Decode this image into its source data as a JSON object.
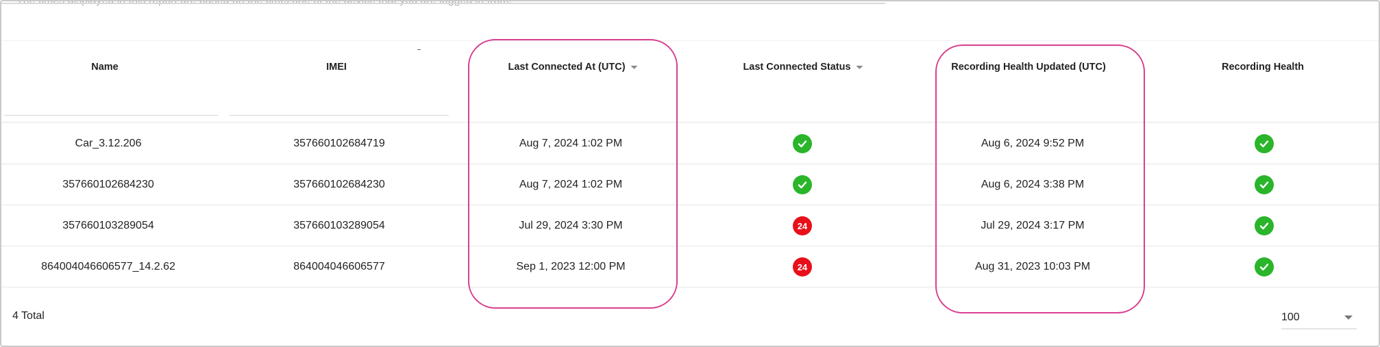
{
  "top_note": "The times displayed in this report are based on the timezone of the device that you are logged in from.",
  "table": {
    "columns": [
      {
        "label": "Name"
      },
      {
        "label": "IMEI"
      },
      {
        "label": "Last Connected At (UTC)"
      },
      {
        "label": "Last Connected Status"
      },
      {
        "label": "Recording Health Updated (UTC)"
      },
      {
        "label": "Recording Health"
      }
    ],
    "rows": [
      {
        "name": "Car_3.12.206",
        "imei": "357660102684719",
        "last_connected_at": "Aug 7, 2024 1:02 PM",
        "last_connected_status": "ok",
        "status_badge": "",
        "recording_health_updated": "Aug 6, 2024 9:52 PM",
        "recording_health": "ok"
      },
      {
        "name": "357660102684230",
        "imei": "357660102684230",
        "last_connected_at": "Aug 7, 2024 1:02 PM",
        "last_connected_status": "ok",
        "status_badge": "",
        "recording_health_updated": "Aug 6, 2024 3:38 PM",
        "recording_health": "ok"
      },
      {
        "name": "357660103289054",
        "imei": "357660103289054",
        "last_connected_at": "Jul 29, 2024 3:30 PM",
        "last_connected_status": "error",
        "status_badge": "24",
        "recording_health_updated": "Jul 29, 2024 3:17 PM",
        "recording_health": "ok"
      },
      {
        "name": "864004046606577_14.2.62",
        "imei": "864004046606577",
        "last_connected_at": "Sep 1, 2023 12:00 PM",
        "last_connected_status": "error",
        "status_badge": "24",
        "recording_health_updated": "Aug 31, 2023 10:03 PM",
        "recording_health": "ok"
      }
    ]
  },
  "footer": {
    "total_label": "4 Total",
    "page_size": "100"
  },
  "colors": {
    "ok": "#2ab52a",
    "error": "#e8101a",
    "highlight": "#d93f8f"
  },
  "icons": {
    "ok": "checkmark-circle-icon",
    "sort": "caret-down-icon"
  }
}
